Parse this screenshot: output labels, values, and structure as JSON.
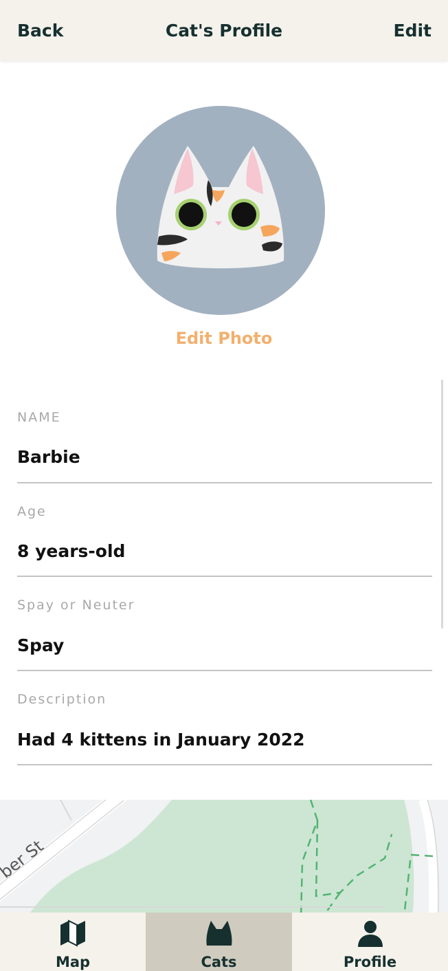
{
  "header": {
    "back_label": "Back",
    "title": "Cat's Profile",
    "edit_label": "Edit"
  },
  "avatar": {
    "edit_photo_label": "Edit Photo",
    "bg_color": "#a2b1c0",
    "accent_color": "#f2b06e"
  },
  "fields": {
    "name": {
      "label": "NAME",
      "value": "Barbie"
    },
    "age": {
      "label": "Age",
      "value": "8 years-old"
    },
    "spay": {
      "label": "Spay or Neuter",
      "value": "Spay"
    },
    "description": {
      "label": "Description",
      "value": "Had 4 kittens in January 2022"
    }
  },
  "map": {
    "street_label": "ber St",
    "park_color": "#cde6d3"
  },
  "tabs": [
    {
      "label": "Map",
      "icon": "map-icon"
    },
    {
      "label": "Cats",
      "icon": "cat-icon",
      "active": true
    },
    {
      "label": "Profile",
      "icon": "person-icon"
    }
  ],
  "colors": {
    "header_bg": "#f5f2eb",
    "primary_text": "#16302f",
    "active_tab_bg": "#cfcbbf"
  }
}
